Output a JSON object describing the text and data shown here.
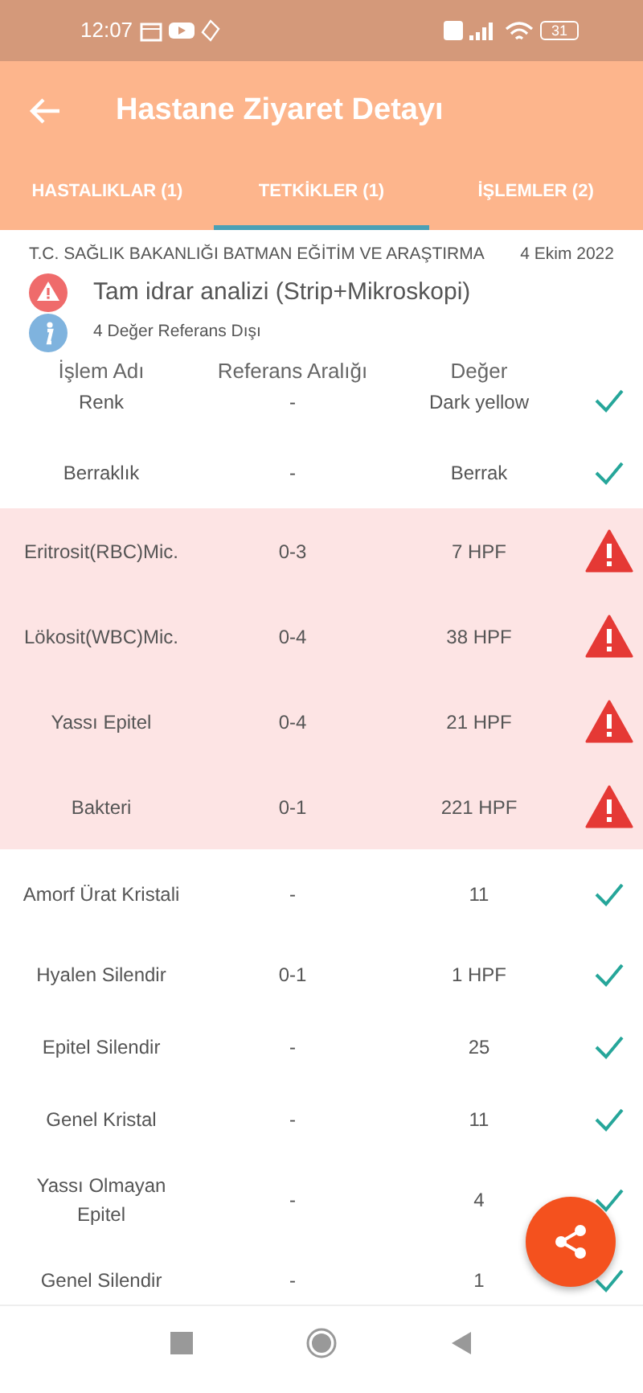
{
  "status_bar": {
    "time": "12:07",
    "battery": "31"
  },
  "app_bar": {
    "title": "Hastane Ziyaret Detayı"
  },
  "tabs": [
    {
      "label": "HASTALIKLAR (1)",
      "selected": false
    },
    {
      "label": "TETKİKLER (1)",
      "selected": true
    },
    {
      "label": "İŞLEMLER (2)",
      "selected": false
    }
  ],
  "test": {
    "hospital": "T.C. SAĞLIK BAKANLIĞI BATMAN EĞİTİM VE ARAŞTIRMA",
    "date": "4 Ekim 2022",
    "name": "Tam idrar analizi (Strip+Mikroskopi)",
    "summary": "4 Değer Referans Dışı"
  },
  "table": {
    "columns": [
      "İşlem Adı",
      "Referans Aralığı",
      "Değer"
    ],
    "rows": [
      {
        "name": "Renk",
        "range": "-",
        "value": "Dark yellow",
        "out_of_range": false
      },
      {
        "name": "Berraklık",
        "range": "-",
        "value": "Berrak",
        "out_of_range": false
      },
      {
        "name": "Eritrosit(RBC)Mic.",
        "range": "0-3",
        "value": "7 HPF",
        "out_of_range": true
      },
      {
        "name": "Lökosit(WBC)Mic.",
        "range": "0-4",
        "value": "38 HPF",
        "out_of_range": true
      },
      {
        "name": "Yassı Epitel",
        "range": "0-4",
        "value": "21 HPF",
        "out_of_range": true
      },
      {
        "name": "Bakteri",
        "range": "0-1",
        "value": "221 HPF",
        "out_of_range": true
      },
      {
        "name": "Amorf Ürat Kristali",
        "range": "-",
        "value": "11",
        "out_of_range": false
      },
      {
        "name": "Hyalen Silendir",
        "range": "0-1",
        "value": "1 HPF",
        "out_of_range": false
      },
      {
        "name": "Epitel Silendir",
        "range": "-",
        "value": "25",
        "out_of_range": false
      },
      {
        "name": "Genel Kristal",
        "range": "-",
        "value": "11",
        "out_of_range": false
      },
      {
        "name": "Yassı Olmayan Epitel",
        "range": "-",
        "value": "4",
        "out_of_range": false
      },
      {
        "name": "Genel Silendir",
        "range": "-",
        "value": "1",
        "out_of_range": false
      }
    ]
  }
}
